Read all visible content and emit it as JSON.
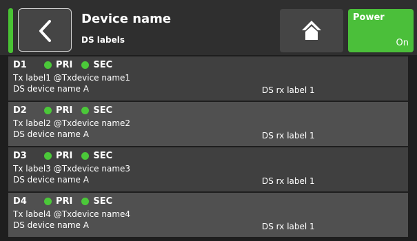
{
  "header": {
    "title": "Device name",
    "subtitle": "DS labels",
    "power_label": "Power",
    "power_state": "On",
    "colors": {
      "accent": "#4bbf3a",
      "header_bg": "#2f2f2f"
    },
    "icons": [
      "chevron-left-icon",
      "home-icon"
    ]
  },
  "rows": [
    {
      "id": "D1",
      "pri": "PRI",
      "sec": "SEC",
      "tx": "Tx label1 @Txdevice name1",
      "device": "DS device name A",
      "rx": "DS rx label 1"
    },
    {
      "id": "D2",
      "pri": "PRI",
      "sec": "SEC",
      "tx": "Tx label2 @Txdevice name2",
      "device": "DS device name A",
      "rx": "DS rx label 1"
    },
    {
      "id": "D3",
      "pri": "PRI",
      "sec": "SEC",
      "tx": "Tx label3 @Txdevice name3",
      "device": "DS device name A",
      "rx": "DS rx label 1"
    },
    {
      "id": "D4",
      "pri": "PRI",
      "sec": "SEC",
      "tx": "Tx label4 @Txdevice name4",
      "device": "DS device name A",
      "rx": "DS rx label 1"
    }
  ]
}
